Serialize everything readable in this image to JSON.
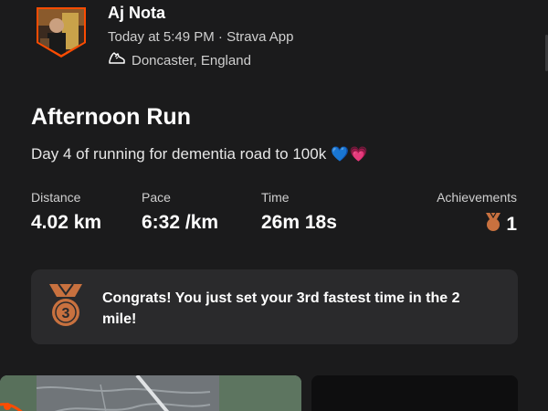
{
  "athlete": {
    "name": "Aj Nota",
    "meta": "Today at 5:49 PM · Strava App",
    "location": "Doncaster, England",
    "activity_icon": "running-shoe-icon"
  },
  "activity": {
    "title": "Afternoon Run",
    "description": "Day 4 of running for dementia road to 100k",
    "description_emoji": "💙💗"
  },
  "stats": {
    "distance_label": "Distance",
    "distance_value": "4.02 km",
    "pace_label": "Pace",
    "pace_value": "6:32 /km",
    "time_label": "Time",
    "time_value": "26m 18s",
    "achievements_label": "Achievements",
    "achievements_value": "1",
    "achievements_icon": "medal-icon"
  },
  "congrats": {
    "text": "Congrats! You just set your 3rd fastest time in the 2 mile!",
    "medal_rank": "3"
  },
  "colors": {
    "background": "#1b1b1c",
    "card": "#2a2a2c",
    "accent_orange": "#fc4c02",
    "medal_bronze": "#c8713f"
  }
}
